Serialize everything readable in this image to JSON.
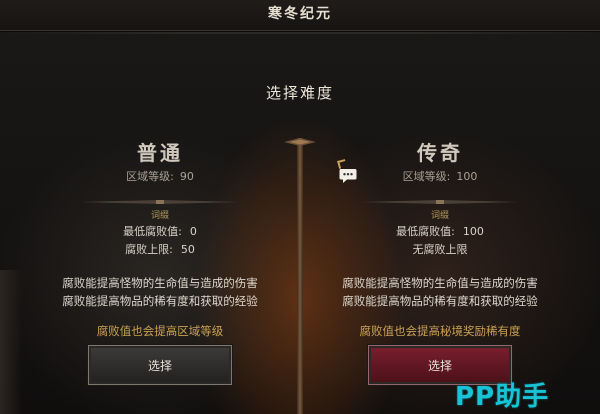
{
  "window": {
    "title": "寒冬纪元"
  },
  "screen": {
    "heading": "选择难度"
  },
  "difficulties": [
    {
      "name": "普通",
      "level_label": "区域等级:",
      "level_value": "90",
      "modifier_label": "词缀",
      "min_corruption_label": "最低腐败值:",
      "min_corruption_value": "0",
      "cap_label": "腐败上限:",
      "cap_value": "50",
      "desc_line1": "腐败能提高怪物的生命值与造成的伤害",
      "desc_line2": "腐败能提高物品的稀有度和获取的经验",
      "note": "腐败值也会提高区域等级",
      "button_label": "选择"
    },
    {
      "name": "传奇",
      "level_label": "区域等级:",
      "level_value": "100",
      "modifier_label": "词缀",
      "min_corruption_label": "最低腐败值:",
      "min_corruption_value": "100",
      "cap_label": "无腐败上限",
      "cap_value": "",
      "desc_line1": "腐败能提高怪物的生命值与造成的伤害",
      "desc_line2": "腐败能提高物品的稀有度和获取的经验",
      "note": "腐败值也会提高秘境奖励稀有度",
      "button_label": "选择"
    }
  ],
  "watermark": "PP助手",
  "colors": {
    "gold": "#c9a253",
    "legend_button": "#7a1f2e",
    "normal_button": "#3d3b3a"
  },
  "icons": [
    "chat-bubble-icon",
    "pillar-ornament-icon"
  ]
}
